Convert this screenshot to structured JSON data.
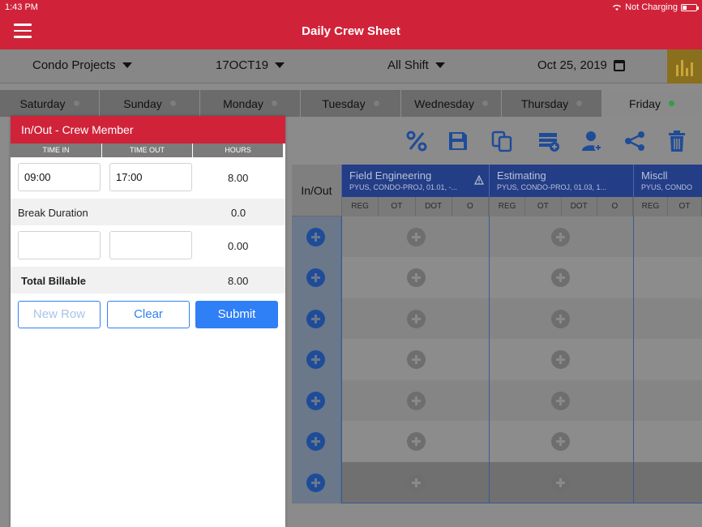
{
  "status_bar": {
    "time": "1:43 PM",
    "battery_text": "Not Charging"
  },
  "header": {
    "title": "Daily Crew Sheet"
  },
  "filters": {
    "project": "Condo Projects",
    "sheet": "17OCT19",
    "shift": "All Shift",
    "date": "Oct 25, 2019"
  },
  "tabs": [
    {
      "label": "Saturday"
    },
    {
      "label": "Sunday"
    },
    {
      "label": "Monday"
    },
    {
      "label": "Tuesday"
    },
    {
      "label": "Wednesday"
    },
    {
      "label": "Thursday"
    },
    {
      "label": "Friday",
      "active": true
    }
  ],
  "grid": {
    "inout_label": "In/Out",
    "columns": [
      {
        "title": "Field Engineering",
        "subtitle": "PYUS, CONDO-PROJ, 01.01, -..."
      },
      {
        "title": "Estimating",
        "subtitle": "PYUS, CONDO-PROJ, 01.03, 1..."
      },
      {
        "title": "Miscll",
        "subtitle": "PYUS, CONDO"
      }
    ],
    "sub_headers": [
      "REG",
      "OT",
      "DOT",
      "O"
    ]
  },
  "popup": {
    "title": "In/Out - Crew Member",
    "headers": {
      "time_in": "TIME IN",
      "time_out": "TIME OUT",
      "hours": "HOURS"
    },
    "row1": {
      "time_in": "09:00",
      "time_out": "17:00",
      "hours": "8.00"
    },
    "break": {
      "label": "Break Duration",
      "value": "0.0"
    },
    "row2": {
      "time_in": "",
      "time_out": "",
      "hours": "0.00"
    },
    "total": {
      "label": "Total Billable",
      "value": "8.00"
    },
    "buttons": {
      "new_row": "New Row",
      "clear": "Clear",
      "submit": "Submit"
    }
  },
  "colors": {
    "brand_red": "#d0233a",
    "accent_blue": "#2f7ff6",
    "active_dot": "#2ea043"
  }
}
